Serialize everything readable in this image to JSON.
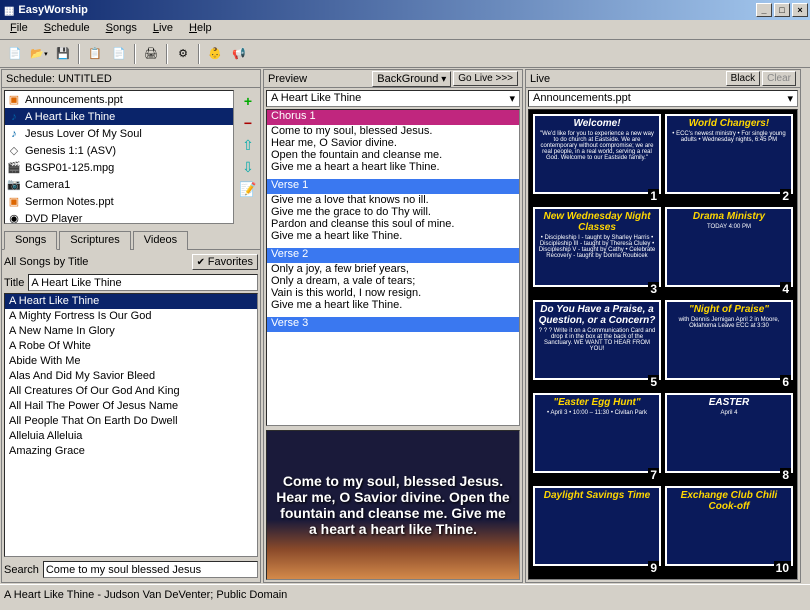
{
  "title": "EasyWorship",
  "menu": [
    "File",
    "Schedule",
    "Songs",
    "Live",
    "Help"
  ],
  "schedule_label": "Schedule: UNTITLED",
  "schedule_items": [
    {
      "icon": "ppt",
      "label": "Announcements.ppt"
    },
    {
      "icon": "song",
      "label": "A Heart Like Thine",
      "sel": true
    },
    {
      "icon": "song",
      "label": "Jesus Lover Of My Soul"
    },
    {
      "icon": "bible",
      "label": "Genesis 1:1 (ASV)"
    },
    {
      "icon": "video",
      "label": "BGSP01-125.mpg"
    },
    {
      "icon": "cam",
      "label": "Camera1"
    },
    {
      "icon": "ppt",
      "label": "Sermon Notes.ppt"
    },
    {
      "icon": "dvd",
      "label": "DVD Player"
    }
  ],
  "tabs": [
    "Songs",
    "Scriptures",
    "Videos"
  ],
  "songs_sort": "All Songs by Title",
  "favorites_label": "Favorites",
  "title_label": "Title",
  "title_value": "A Heart Like Thine",
  "songlist": [
    "A Heart Like Thine",
    "A Mighty Fortress Is Our God",
    "A New Name In Glory",
    "A Robe Of White",
    "Abide With Me",
    "Alas And Did My Savior Bleed",
    "All Creatures Of Our God And King",
    "All Hail The Power Of Jesus Name",
    "All People That On Earth Do Dwell",
    "Alleluia Alleluia",
    "Amazing Grace"
  ],
  "search_label": "Search",
  "search_value": "Come to my soul blessed Jesus",
  "preview_label": "Preview",
  "background_btn": "BackGround",
  "golive_btn": "Go Live >>>",
  "preview_title": "A Heart Like Thine",
  "lyrics": [
    {
      "h": "Chorus 1",
      "cls": "chorus",
      "t": "Come to my soul, blessed Jesus.\nHear me, O Savior divine.\nOpen the fountain and cleanse me.\nGive me a heart a heart like Thine."
    },
    {
      "h": "Verse 1",
      "cls": "verse",
      "t": "Give me a love that knows no ill.\nGive me the grace to do Thy will.\nPardon and cleanse this soul of mine.\nGive me a heart like Thine."
    },
    {
      "h": "Verse 2",
      "cls": "verse",
      "t": "Only a joy, a few brief years,\nOnly a dream, a vale of tears;\nVain is this world, I now resign.\nGive me a heart like Thine."
    },
    {
      "h": "Verse 3",
      "cls": "verse",
      "t": ""
    }
  ],
  "preview_text": "Come to my soul, blessed Jesus. Hear me, O Savior divine. Open the fountain and cleanse me. Give me a heart a heart like Thine.",
  "live_label": "Live",
  "black_btn": "Black",
  "clear_btn": "Clear",
  "live_title": "Announcements.ppt",
  "slides": [
    {
      "n": 1,
      "title": "Welcome!",
      "sub": "\"We'd like for you to experience a new way to do church at Eastside. We are contemporary without compromise; we are real people, in a real world, serving a real God. Welcome to our Eastside family.\"",
      "color": "#fff"
    },
    {
      "n": 2,
      "title": "World Changers!",
      "sub": "• ECC's newest ministry\n• For single young adults\n• Wednesday nights, 6:45 PM",
      "color": "gold"
    },
    {
      "n": 3,
      "title": "New Wednesday Night Classes",
      "sub": "• Discipleship I - taught by Sharley Harris\n• Discipleship III - taught by Theresa Cluley\n• Discipleship V - taught by Cathy\n• Celebrate Recovery - taught by Donna Roubicek",
      "color": "gold"
    },
    {
      "n": 4,
      "title": "Drama Ministry",
      "sub": "TODAY\n4:00 PM",
      "color": "gold"
    },
    {
      "n": 5,
      "title": "Do You Have a Praise, a Question, or a Concern?",
      "sub": "? ? ?\nWrite it on a Communication Card and drop it in the box at the back of the Sanctuary.\nWE WANT TO HEAR FROM YOU!",
      "color": "#fff"
    },
    {
      "n": 6,
      "title": "\"Night of Praise\"",
      "sub": "with Dennis Jernigan\n\nApril 2 in Moore, Oklahoma\nLeave ECC at 3:30",
      "color": "gold"
    },
    {
      "n": 7,
      "title": "\"Easter Egg Hunt\"",
      "sub": "• April 3\n• 10:00 – 11:30\n• Civitan Park",
      "color": "gold"
    },
    {
      "n": 8,
      "title": "EASTER",
      "sub": "April 4",
      "color": "#fff"
    },
    {
      "n": 9,
      "title": "Daylight Savings Time",
      "sub": "",
      "color": "gold"
    },
    {
      "n": 10,
      "title": "Exchange Club Chili Cook-off",
      "sub": "",
      "color": "gold"
    }
  ],
  "statusbar": "A Heart Like Thine - Judson Van DeVenter; Public Domain"
}
